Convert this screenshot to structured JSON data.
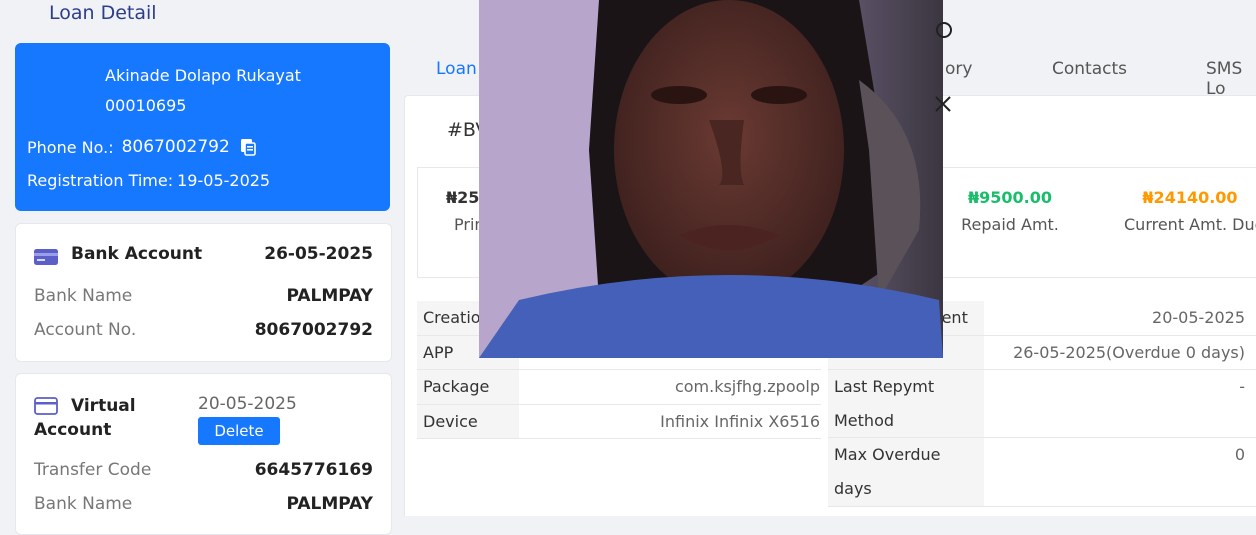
{
  "page": {
    "title": "Loan Detail"
  },
  "profile": {
    "name": "Akinade Dolapo Rukayat",
    "id": "00010695",
    "phone_label": "Phone No.:",
    "phone": "8067002792",
    "reg_label": "Registration Time:",
    "reg_time": "19-05-2025"
  },
  "bank_account": {
    "title": "Bank Account",
    "date": "26-05-2025",
    "rows": [
      {
        "label": "Bank Name",
        "value": "PALMPAY"
      },
      {
        "label": "Account No.",
        "value": "8067002792"
      }
    ]
  },
  "virtual_account": {
    "title_line1": "Virtual",
    "title_line2": "Account",
    "date": "20-05-2025",
    "delete_label": "Delete",
    "rows": [
      {
        "label": "Transfer Code",
        "value": "6645776169"
      },
      {
        "label": "Bank Name",
        "value": "PALMPAY"
      }
    ]
  },
  "tabs": [
    {
      "label": "Loan"
    },
    {
      "label": "ory"
    },
    {
      "label": "Contacts"
    },
    {
      "label": "SMS Lo"
    }
  ],
  "loan": {
    "number_prefix": "#BV",
    "amounts": [
      {
        "value": "₦250",
        "caption": "Prin",
        "color": "#222222"
      },
      {
        "value": "₦9500.00",
        "caption": "Repaid Amt.",
        "color": "#19be6b"
      },
      {
        "value": "₦24140.00",
        "caption": "Current Amt. Due",
        "color": "#ff9900"
      }
    ],
    "left_table": [
      {
        "label": "Creatio",
        "value": ""
      },
      {
        "label": "APP",
        "value": ""
      },
      {
        "label": "Package",
        "value": "com.ksjfhg.zpoolp"
      },
      {
        "label": "Device",
        "value": "Infinix Infinix X6516"
      }
    ],
    "right_table": [
      {
        "label": "ment",
        "value": "20-05-2025"
      },
      {
        "label": "",
        "value": "26-05-2025(Overdue 0 days)"
      },
      {
        "label": "Last Repymt",
        "value": "-"
      },
      {
        "label": "Method",
        "value": ""
      },
      {
        "label": "Max Overdue",
        "value": "0"
      },
      {
        "label": "days",
        "value": ""
      }
    ]
  }
}
